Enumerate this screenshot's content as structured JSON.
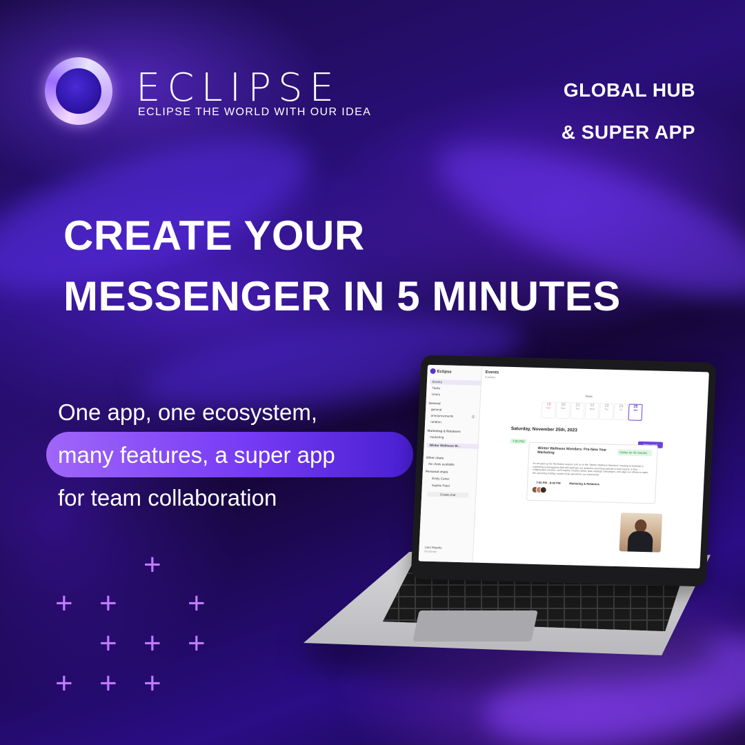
{
  "brand": {
    "name": "ECLIPSE",
    "tagline": "ECLIPSE THE WORLD WITH OUR IDEA"
  },
  "corner": {
    "line1": "GLOBAL HUB",
    "line2": "&  SUPER APP"
  },
  "headline": {
    "line1": "CREATE YOUR",
    "line2": "MESSENGER IN 5 MINUTES"
  },
  "subtext": {
    "line1": "One app, one ecosystem,",
    "line2": "many features, a super app",
    "line3": "for team collaboration"
  },
  "colors": {
    "background": "#1a0b4a",
    "accent": "#7b3dff",
    "plus": "#c27bff"
  },
  "app": {
    "title": "Eclipse",
    "sidebar": {
      "items": [
        "Events",
        "Tasks",
        "Users"
      ],
      "general_label": "General",
      "general_items": [
        "general",
        "announcements",
        "random"
      ],
      "general_badge": "2",
      "group_label": "Marketing & Relations",
      "group_items": [
        "marketing"
      ],
      "chat_title": "Winter Wellness W...",
      "other_label": "Other chats",
      "no_chats": "No chats available",
      "personal_label": "Personal chats",
      "personal_items": [
        "Emily Carter",
        "Sophie Patel"
      ],
      "create_chat": "Create chat",
      "profile_name": "Liam Murphy",
      "profile_role": "Frontend"
    },
    "header": {
      "title": "Events",
      "subtitle": "9 events",
      "tasks": "Tasks"
    },
    "days": [
      {
        "num": "19",
        "label": "Sun"
      },
      {
        "num": "20",
        "label": "Mon"
      },
      {
        "num": "21",
        "label": "Tue"
      },
      {
        "num": "22",
        "label": "Wed"
      },
      {
        "num": "23",
        "label": "Thu"
      },
      {
        "num": "24",
        "label": "Fri"
      },
      {
        "num": "25",
        "label": "Sat"
      }
    ],
    "date": "Saturday, November 25th, 2023",
    "new_event": "New event",
    "time_badge": "7:00 PM",
    "event": {
      "title": "Winter Wellness Wonders: Pre-New Year Marketing",
      "status": "Online for 45 minutes",
      "description": "As we gear up for the festive season, join us in the \"Winter Wellness Wonders\" meeting to kickstart a marketing extravaganza that will captivate our audience and bring warmth to their hearts. In this collaborative session, we'll explore creative ideas, plan strategic campaigns, and align our efforts to make the upcoming holiday season truly special for our community.",
      "time": "7:00 PM - 8:00 PM",
      "team": "Marketing & Relations"
    }
  }
}
